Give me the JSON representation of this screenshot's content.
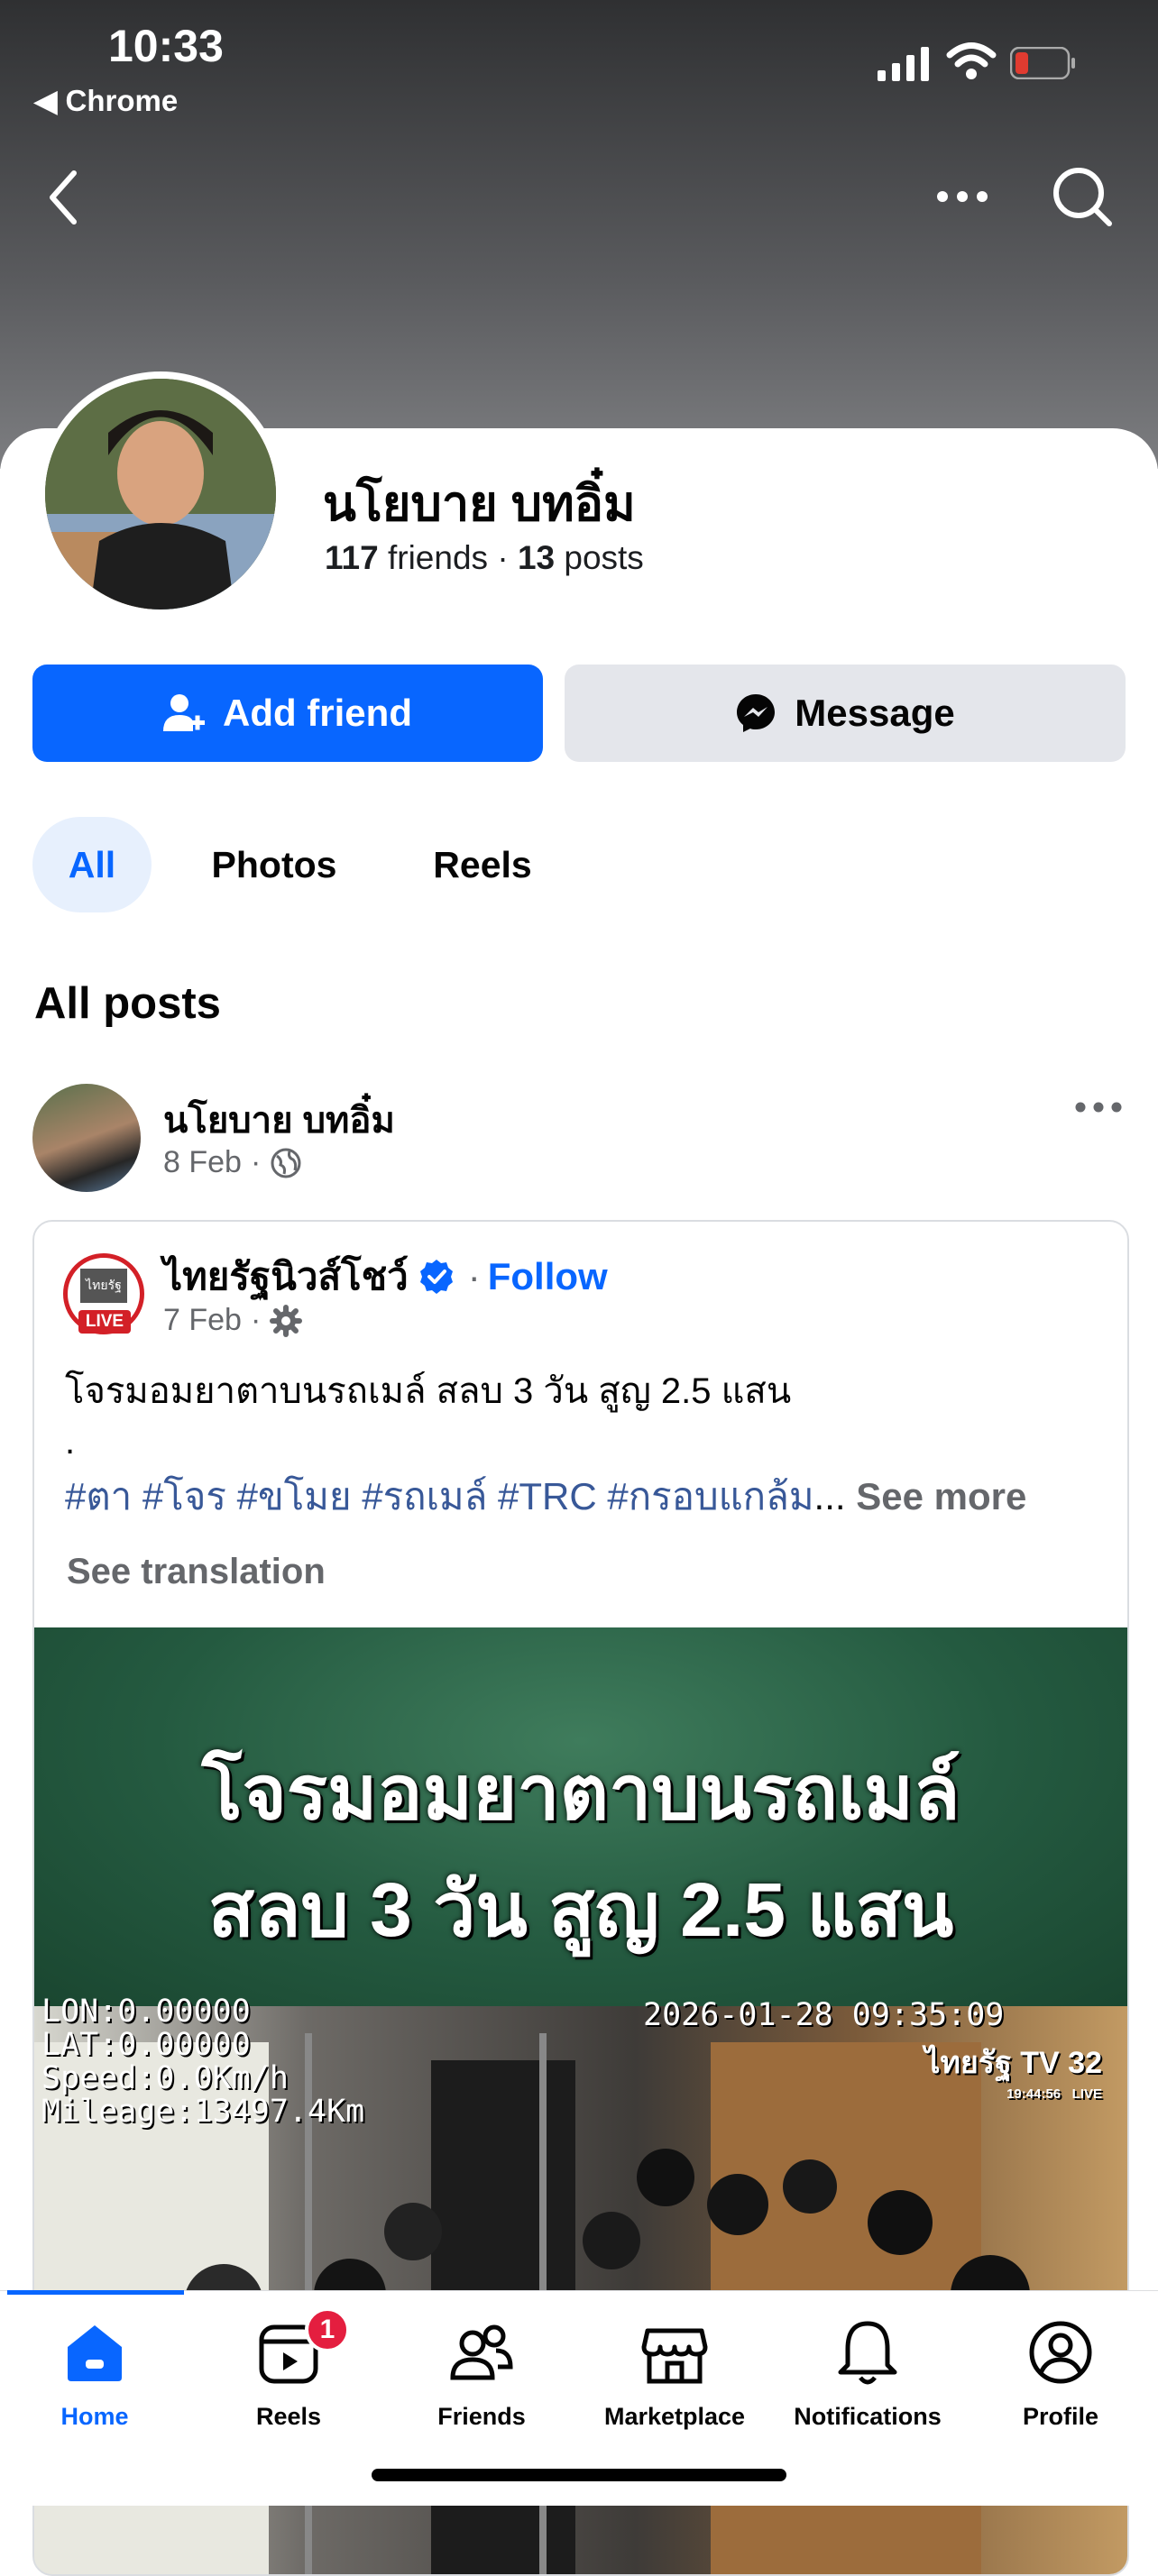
{
  "status_bar": {
    "time": "10:33",
    "back_app": "◀ Chrome"
  },
  "profile": {
    "name": "นโยบาย บทอิ๋ม",
    "friends_count": "117",
    "friends_label": " friends",
    "separator": " · ",
    "posts_count": "13",
    "posts_label": " posts"
  },
  "actions": {
    "add_friend": "Add friend",
    "message": "Message"
  },
  "tabs": [
    {
      "label": "All"
    },
    {
      "label": "Photos"
    },
    {
      "label": "Reels"
    }
  ],
  "section_title": "All posts",
  "post": {
    "author": "นโยบาย บทอิ๋ม",
    "date": "8 Feb",
    "dot": "·",
    "shared": {
      "page_name": "ไทยรัฐนิวส์โชว์",
      "dot": "·",
      "follow": "Follow",
      "logo_live": "LIVE",
      "logo_mark": "ไทยรัฐ",
      "date": "7 Feb",
      "caption": "โจรมอมยาตาบนรถเมล์ สลบ 3 วัน สูญ 2.5 แสน",
      "caption_dot": ".",
      "hashtags": "#ตา #โจร #ขโมย #รถเมล์ #TRC #กรอบแกล้ม",
      "ellipsis": "...",
      "see_more": "See more",
      "see_translation": "See translation",
      "media": {
        "headline_1": "โจรมอมยาตาบนรถเมล์",
        "headline_2": "สลบ 3 วัน สูญ 2.5 แสน",
        "osd_lon": "LON:0.00000",
        "osd_lat": "LAT:0.00000",
        "osd_speed": "Speed:0.0Km/h",
        "osd_mileage": "Mileage:13497.4Km",
        "osd_datetime": "2026-01-28 09:35:09",
        "tv_logo": "ไทยรัฐ TV 32",
        "tv_time": "19:44:56",
        "tv_live": "LIVE"
      }
    }
  },
  "bottom_nav": {
    "items": [
      {
        "label": "Home"
      },
      {
        "label": "Reels",
        "badge": "1"
      },
      {
        "label": "Friends"
      },
      {
        "label": "Marketplace"
      },
      {
        "label": "Notifications"
      },
      {
        "label": "Profile"
      }
    ]
  },
  "colors": {
    "accent": "#0866ff",
    "badge": "#e41e3f",
    "live_red": "#d32027"
  }
}
